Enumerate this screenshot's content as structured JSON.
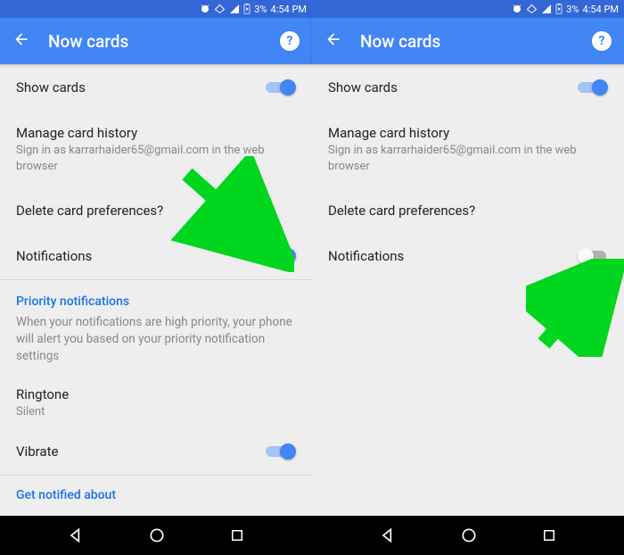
{
  "statusbar": {
    "battery": "3%",
    "time": "4:54 PM"
  },
  "appbar": {
    "title": "Now cards",
    "help": "?"
  },
  "left": {
    "show_cards": "Show cards",
    "manage_history_title": "Manage card history",
    "manage_history_sub": "Sign in as karrarhaider65@gmail.com in the web browser",
    "delete_prefs": "Delete card preferences?",
    "notifications": "Notifications",
    "priority_section": "Priority notifications",
    "priority_desc": "When your notifications are high priority, your phone will alert you based on your priority notification settings",
    "ringtone_title": "Ringtone",
    "ringtone_value": "Silent",
    "vibrate": "Vibrate",
    "get_notified": "Get notified about"
  },
  "right": {
    "show_cards": "Show cards",
    "manage_history_title": "Manage card history",
    "manage_history_sub": "Sign in as karrarhaider65@gmail.com in the web browser",
    "delete_prefs": "Delete card preferences?",
    "notifications": "Notifications"
  },
  "toggles": {
    "left_show_cards": true,
    "left_notifications": true,
    "left_vibrate": true,
    "right_show_cards": true,
    "right_notifications": false
  },
  "annotation_color": "#00d61e"
}
